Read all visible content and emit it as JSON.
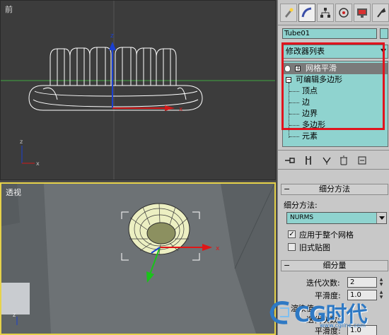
{
  "viewports": {
    "front_label": "前",
    "persp_label": "透视"
  },
  "panel": {
    "tabs": [
      "create-icon",
      "modify-icon",
      "hierarchy-icon",
      "motion-icon",
      "display-icon",
      "utilities-icon"
    ],
    "object_name": "Tube01",
    "modifier_list": "修改器列表",
    "stack": {
      "mesh_smooth": "网格平滑",
      "editable_poly": "可编辑多边形",
      "sub_vertex": "顶点",
      "sub_edge": "边",
      "sub_border": "边界",
      "sub_polygon": "多边形",
      "sub_element": "元素"
    },
    "subdivision_method": {
      "title": "细分方法",
      "method_label": "细分方法:",
      "method_value": "NURMS",
      "apply_whole_mesh": "应用于整个网格",
      "apply_whole_mesh_checked": true,
      "old_style_mapping": "旧式贴图",
      "old_style_mapping_checked": false
    },
    "subdivision_amount": {
      "title": "细分量",
      "iterations_label": "迭代次数:",
      "iterations_value": "2",
      "smoothness_label": "平滑度:",
      "smoothness_value": "1.0",
      "render_values_label": "渲染值",
      "render_iterations_label": "迭代次数:",
      "render_smoothness_label": "平滑度:",
      "render_smoothness_value": "1.0"
    }
  },
  "watermark": {
    "brand": "CG时代",
    "url": "www.cgline.com"
  },
  "colors": {
    "accent_highlight": "#e0141e",
    "field_bg": "#8fd3cf",
    "active_viewport_border": "#e6d24a"
  }
}
